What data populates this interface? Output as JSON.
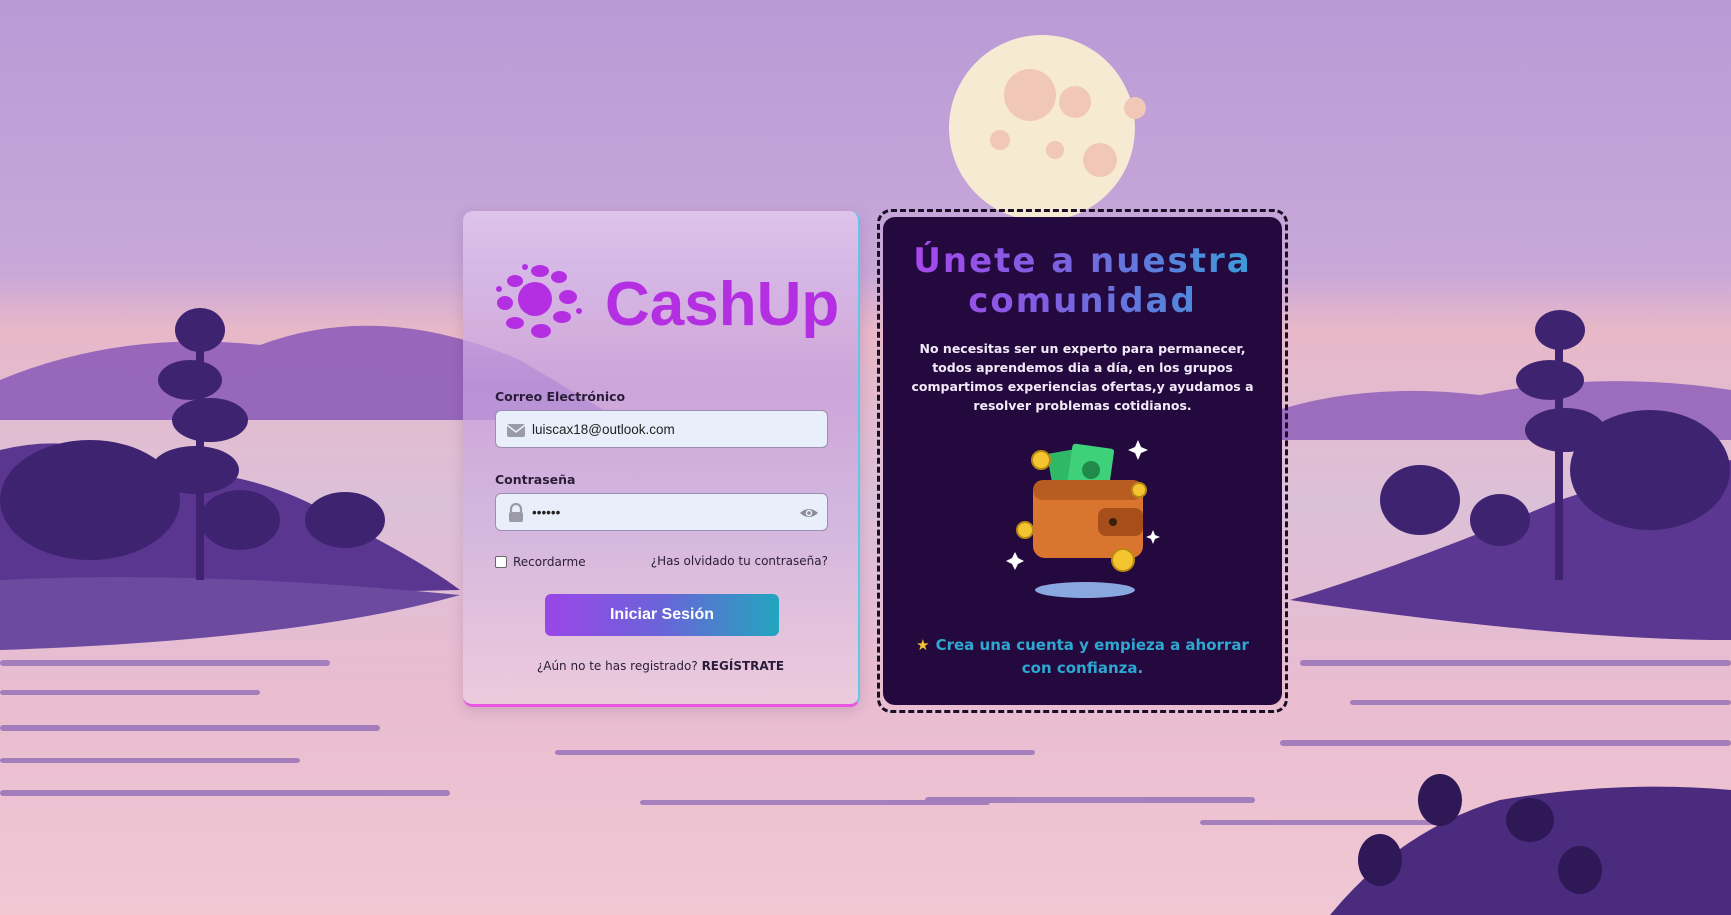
{
  "brand": {
    "name": "CashUp"
  },
  "login": {
    "email_label": "Correo Electrónico",
    "email_value": "luiscax18@outlook.com",
    "password_label": "Contraseña",
    "password_value": "••••••",
    "remember_label": "Recordarme",
    "remember_checked": false,
    "forgot_link": "¿Has olvidado tu contraseña?",
    "submit_label": "Iniciar Sesión",
    "register_prompt": "¿Aún no te has registrado?",
    "register_link": "REGÍSTRATE"
  },
  "community": {
    "title": "Únete a nuestra comunidad",
    "description": "No necesitas ser un experto para permanecer, todos aprendemos dia a día, en los grupos compartimos experiencias ofertas,y ayudamos a resolver problemas cotidianos.",
    "cta": "Crea una cuenta y empieza a ahorrar con confianza.",
    "cta_icon": "star-icon"
  },
  "colors": {
    "brand": "#b52fe2",
    "button_start": "#9a46e8",
    "button_end": "#22a6be",
    "community_bg": "#24093f",
    "cta_text": "#2ea8d0"
  }
}
